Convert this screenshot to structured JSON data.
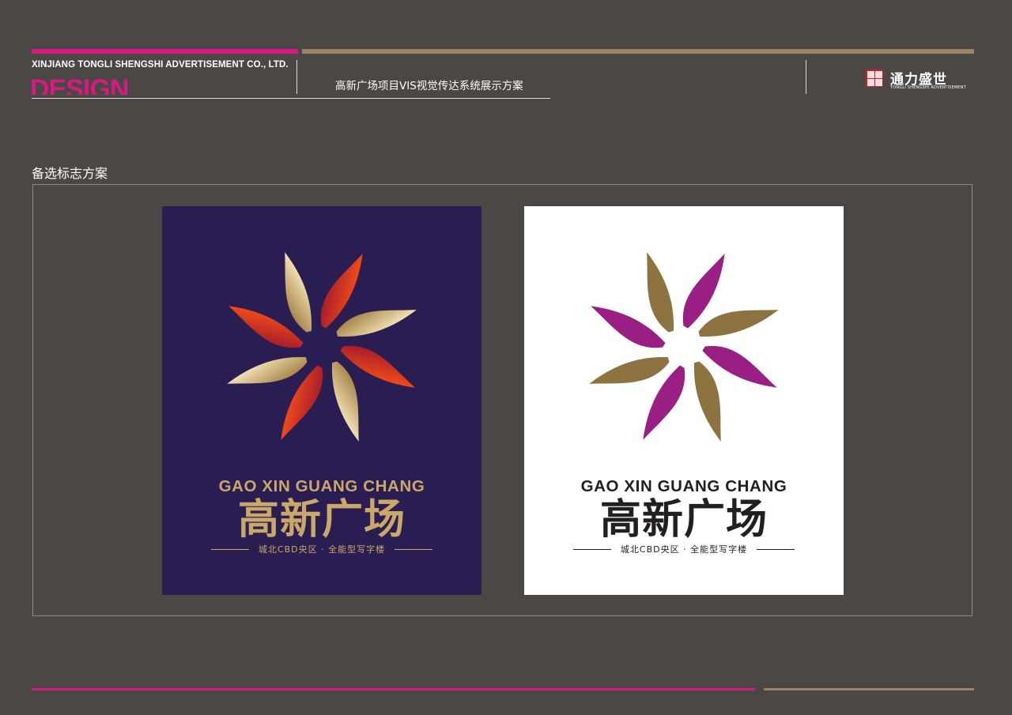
{
  "header": {
    "company": "XINJIANG TONGLI SHENGSHI ADVERTISEMENT CO., LTD.",
    "design_word": "DESIGN",
    "project_title": "高新广场项目VIS视觉传达系统展示方案",
    "brand_name": "通力盛世",
    "brand_subtitle": "TONGLI SHENGSHI ADVERTISEMENT"
  },
  "section_title": "备选标志方案",
  "cards": [
    {
      "variant": "dark",
      "background": "#2a1d52",
      "pinyin": "GAO XIN GUANG CHANG",
      "chinese_name": "高新广场",
      "tagline": "城北CBD央区 · 全能型写字楼",
      "petal_colors": [
        "#e8431c",
        "#d9c08a"
      ]
    },
    {
      "variant": "light",
      "background": "#ffffff",
      "pinyin": "GAO XIN GUANG CHANG",
      "chinese_name": "高新广场",
      "tagline": "城北CBD央区 · 全能型写字楼",
      "petal_colors": [
        "#9a1f84",
        "#8d7340"
      ]
    }
  ],
  "colors": {
    "accent_magenta": "#d51a80",
    "accent_gold": "#9a8466",
    "page_background": "#4a4745"
  }
}
